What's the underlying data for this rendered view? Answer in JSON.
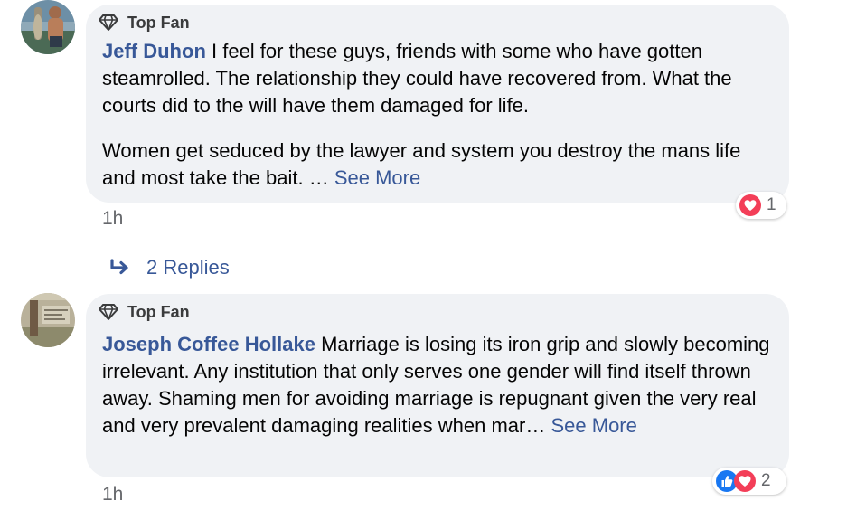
{
  "comments": [
    {
      "badge": "Top Fan",
      "author": "Jeff Duhon",
      "paragraph1": " I feel for these guys, friends with some who have gotten steamrolled. The relationship they could have recovered from. What the courts did to the will have them damaged for life.",
      "paragraph2": "Women get seduced by the lawyer and system you destroy the mans life and most take the bait. … ",
      "see_more": "See More",
      "time": "1h",
      "reaction_count": "1",
      "reaction_icons": [
        "love-icon"
      ],
      "replies_label": "2 Replies"
    },
    {
      "badge": "Top Fan",
      "author": "Joseph Coffee Hollake",
      "paragraph1": " Marriage is losing its iron grip and slowly becoming irrelevant. Any institution that only serves one gender will find itself thrown away. Shaming men for avoiding marriage is repugnant given the very real and very prevalent damaging realities when mar… ",
      "see_more": "See More",
      "time": "1h",
      "reaction_count": "2",
      "reaction_icons": [
        "like-icon",
        "love-icon"
      ]
    }
  ],
  "colors": {
    "link": "#385898",
    "bubble": "#f0f2f5",
    "secondary_text": "#65676b",
    "love": "#f33e58",
    "like": "#1877f2"
  }
}
